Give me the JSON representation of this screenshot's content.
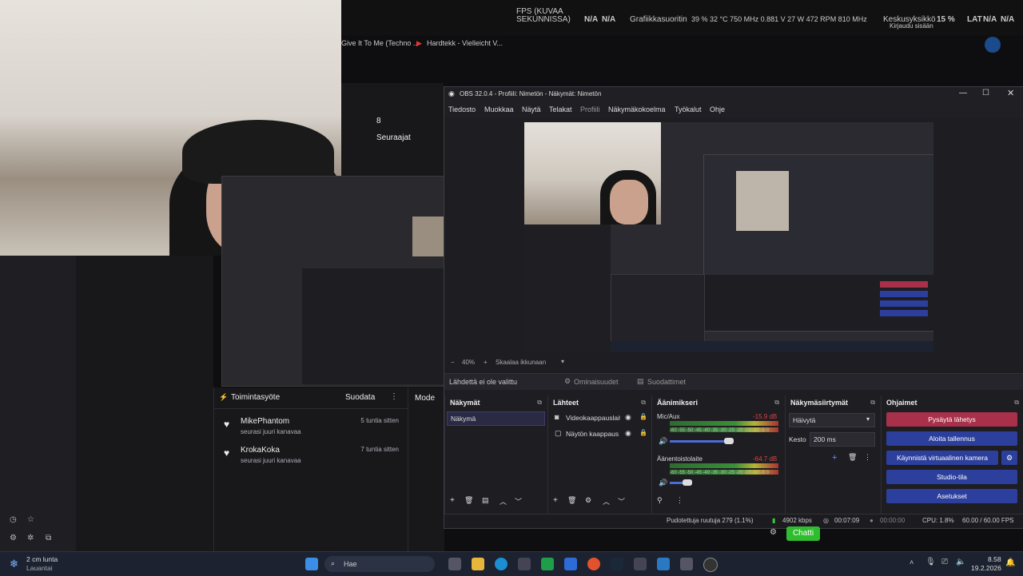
{
  "stats": {
    "fps_label": "FPS (KUVAA",
    "fps_label2": "SEKUNNISSA)",
    "na1": "N/A",
    "na2": "N/A",
    "gpu": "Grafiikkasuoritin",
    "gpu_vals": "39 % 32 °C 750 MHz 0.881 V 27 W 472 RPM 810 MHz",
    "cpu": "Keskusyksikkö",
    "cpu_val": "15 %",
    "lat": "LAT",
    "lat_na1": "N/A",
    "lat_na2": "N/A",
    "login": "Kirjaudu sisään"
  },
  "bookmarks": [
    "Give It To Me (Techno ...",
    "Hardtekk - Vielleicht V..."
  ],
  "twitch": {
    "followers_count": "8",
    "followers_label": "Seuraajat"
  },
  "activity": {
    "title": "Toimintasyöte",
    "filter": "Suodata",
    "items": [
      {
        "name": "MikePhantom",
        "text": "seurasi juuri kanavaa",
        "time": "5 tuntia sitten"
      },
      {
        "name": "KrokaKoka",
        "text": "seurasi juuri kanavaa",
        "time": "7 tuntia sitten"
      }
    ],
    "modes_label": "Mode"
  },
  "obs": {
    "title": "OBS 32.0.4 - Profiili: Nimetön - Näkymät: Nimetön",
    "menu": [
      "Tiedosto",
      "Muokkaa",
      "Näytä",
      "Telakat",
      "Profiili",
      "Näkymäkokoelma",
      "Työkalut",
      "Ohje"
    ],
    "zoom": "40%",
    "scale_label": "Skaalaa ikkunaan",
    "no_source": "Lähdettä ei ole valittu",
    "properties": "Ominaisuudet",
    "filters": "Suodattimet",
    "docks": {
      "scenes": "Näkymät",
      "sources": "Lähteet",
      "mixer": "Äänimikseri",
      "transitions": "Näkymäsiirtymät",
      "controls": "Ohjaimet"
    },
    "scene_item": "Näkymä",
    "source_items": [
      "Videokaappauslaite",
      "Näytön kaappaus"
    ],
    "mixer": [
      {
        "name": "Mic/Aux",
        "db": "-15.9 dB"
      },
      {
        "name": "Äänentoistolaite",
        "db": "-64.7 dB"
      }
    ],
    "mixer_scale": "-60 -55 -50 -45 -40 -35 -30 -25 -20 -15 -10 -5 0",
    "transition": "Häivytä",
    "duration_label": "Kesto",
    "duration_value": "200 ms",
    "controls": {
      "stop_stream": "Pysäytä lähetys",
      "start_record": "Aloita tallennus",
      "virtual_cam": "Käynnistä virtuaalinen kamera",
      "studio": "Studio-tila",
      "settings": "Asetukset"
    },
    "status": {
      "dropped": "Pudotettuja ruutuja 279 (1.1%)",
      "kbps": "4902 kbps",
      "live_time": "00:07:09",
      "rec_time": "00:00:00",
      "cpu": "CPU: 1.8%",
      "fps": "60.00 / 60.00 FPS"
    },
    "colors": {
      "stop": "#a8304a",
      "blue": "#2c3f9c"
    }
  },
  "chat_button": "Chatti",
  "taskbar": {
    "weather_temp": "2 cm lunta",
    "weather_day": "Lauantai",
    "search": "Hae",
    "time": "8.58",
    "date": "19.2.2026"
  }
}
